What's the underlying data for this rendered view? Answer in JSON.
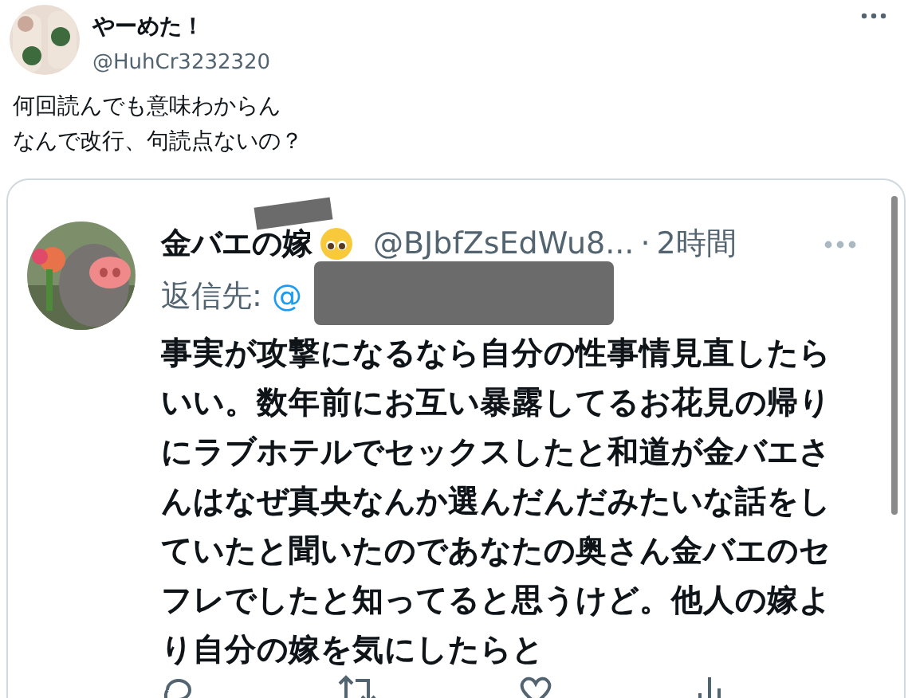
{
  "tweet": {
    "name": "やーめた！",
    "handle": "@HuhCr3232320",
    "text": [
      "何回読んでも意味わからん",
      "なんで改行、句読点ないの？"
    ]
  },
  "quote": {
    "name": "金バエの嫁",
    "handle": "@BJbfZsEdWu8...",
    "separator": "·",
    "time": "2時間",
    "reply_label": "返信先:",
    "reply_to": "@",
    "text": "事実が攻撃になるなら自分の性事情見直したらいい。数年前にお互い暴露してるお花見の帰りにラブホテルでセックスしたと和道が金バエさんはなぜ真央なんか選んだんだみたいな話をしていたと聞いたのであなたの奥さん金バエのセフレでしたと知ってると思うけど。他人の嫁より自分の嫁を気にしたらと"
  }
}
